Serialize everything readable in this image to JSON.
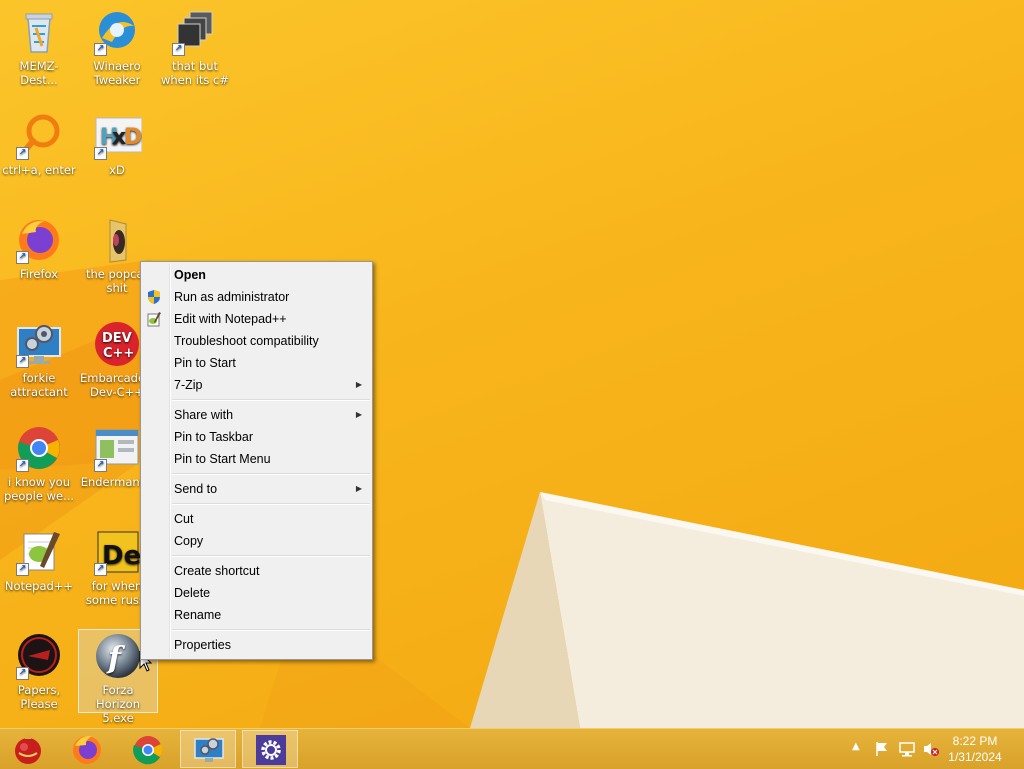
{
  "desktop": {
    "icons": [
      {
        "label": "MEMZ-Dest...",
        "icon": "recycle-bin-icon"
      },
      {
        "label": "Winaero Tweaker",
        "icon": "winaero-icon"
      },
      {
        "label": "that but when its c#",
        "icon": "windows-stack-icon"
      },
      {
        "label": "ctrl+a, enter",
        "icon": "magnifier-icon"
      },
      {
        "label": "xD",
        "icon": "hxd-icon"
      },
      {
        "label": "Firefox",
        "icon": "firefox-icon"
      },
      {
        "label": "the popcat shit",
        "icon": "folder-icon"
      },
      {
        "label": "forkie attractant",
        "icon": "monitor-gear-icon"
      },
      {
        "label": "Embarcadero Dev-C++",
        "icon": "devcpp-icon"
      },
      {
        "label": "i know you people we...",
        "icon": "chrome-icon"
      },
      {
        "label": "Endermanch",
        "icon": "window-app-icon"
      },
      {
        "label": "Notepad++",
        "icon": "notepadpp-icon"
      },
      {
        "label": "for when some russi",
        "icon": "de-icon"
      },
      {
        "label": "Papers, Please",
        "icon": "papers-please-icon"
      },
      {
        "label": "Forza Horizon 5.exe",
        "icon": "flash-icon"
      }
    ]
  },
  "context_menu": {
    "items": [
      {
        "label": "Open"
      },
      {
        "label": "Run as administrator",
        "icon": "shield-icon"
      },
      {
        "label": "Edit with Notepad++",
        "icon": "notepadpp-small-icon"
      },
      {
        "label": "Troubleshoot compatibility"
      },
      {
        "label": "Pin to Start"
      },
      {
        "label": "7-Zip",
        "submenu": true
      },
      {
        "label": "Share with",
        "submenu": true
      },
      {
        "label": "Pin to Taskbar"
      },
      {
        "label": "Pin to Start Menu"
      },
      {
        "label": "Send to",
        "submenu": true
      },
      {
        "label": "Cut"
      },
      {
        "label": "Copy"
      },
      {
        "label": "Create shortcut"
      },
      {
        "label": "Delete"
      },
      {
        "label": "Rename"
      },
      {
        "label": "Properties"
      }
    ]
  },
  "taskbar": {
    "buttons": [
      {
        "icon": "ornament-start-icon"
      },
      {
        "icon": "firefox-icon"
      },
      {
        "icon": "chrome-icon"
      },
      {
        "icon": "monitor-gear-icon",
        "active": true
      },
      {
        "icon": "settings-gear-icon",
        "active": true
      }
    ],
    "tray": {
      "icons": [
        "show-hidden-icons-chevron",
        "action-center-flag-icon",
        "network-icon",
        "volume-muted-icon"
      ]
    },
    "clock": {
      "time": "8:22 PM",
      "date": "1/31/2024"
    }
  },
  "colors": {
    "wallpaper": "#f8b51b",
    "taskbar": "#dca52e",
    "menu_bg": "#f0f0f0"
  }
}
